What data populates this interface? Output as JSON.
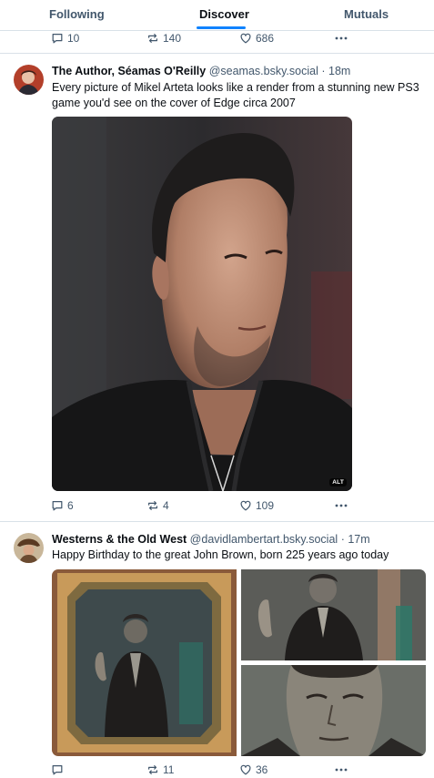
{
  "tabs": [
    {
      "label": "Following"
    },
    {
      "label": "Discover"
    },
    {
      "label": "Mutuals"
    }
  ],
  "colors": {
    "accent": "#1083fe",
    "muted": "#42576c",
    "border": "#d9e1e8"
  },
  "prev_post": {
    "replies": "10",
    "reposts": "140",
    "likes": "686"
  },
  "posts": [
    {
      "author": "The Author, Séamas O'Reilly",
      "handle": "@seamas.bsky.social",
      "separator": "·",
      "time": "18m",
      "text": "Every picture of Mikel Arteta looks like a render from a stunning new PS3 game you'd see on the cover of Edge circa 2007",
      "alt_badge": "ALT",
      "replies": "6",
      "reposts": "4",
      "likes": "109"
    },
    {
      "author": "Westerns & the Old West",
      "handle": "@davidlambertart.bsky.social",
      "separator": "·",
      "time": "17m",
      "text": "Happy Birthday to the great John Brown, born 225 years ago today",
      "replies": "",
      "reposts": "11",
      "likes": "36"
    }
  ],
  "icons": {
    "reply": "reply-icon",
    "repost": "repost-icon",
    "like": "heart-icon",
    "more": "more-icon"
  }
}
